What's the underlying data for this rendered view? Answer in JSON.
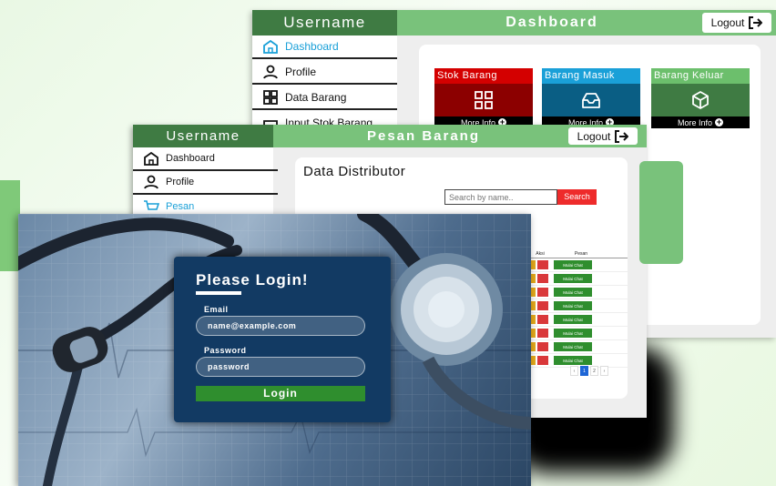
{
  "dashboard": {
    "username": "Username",
    "title": "Dashboard",
    "logout": "Logout",
    "sidebar": [
      {
        "label": "Dashboard",
        "icon": "home-icon",
        "active": true
      },
      {
        "label": "Profile",
        "icon": "user-icon"
      },
      {
        "label": "Data Barang",
        "icon": "grid-icon"
      },
      {
        "label": "Input Stok Barang",
        "icon": "inbox-icon"
      }
    ],
    "cards": [
      {
        "title": "Stok Barang",
        "more": "More Info",
        "icon": "grid-icon",
        "head_color": "#d40000",
        "body_color": "#8c0000"
      },
      {
        "title": "Barang Masuk",
        "more": "More Info",
        "icon": "inbox-icon",
        "head_color": "#1aa0d8",
        "body_color": "#0a5e84"
      },
      {
        "title": "Barang Keluar",
        "more": "More Info",
        "icon": "box-icon",
        "head_color": "#6cbf6c",
        "body_color": "#3f7b43"
      }
    ]
  },
  "pesan": {
    "username": "Username",
    "title": "Pesan Barang",
    "logout": "Logout",
    "sidebar": [
      {
        "label": "Dashboard",
        "icon": "home-icon"
      },
      {
        "label": "Profile",
        "icon": "user-icon"
      },
      {
        "label": "Pesan",
        "icon": "cart-icon",
        "active": true
      }
    ],
    "main_title": "Data Distributor",
    "search_placeholder": "Search by name..",
    "search_button": "Search",
    "table_headers": [
      "Aksi",
      "Pesan"
    ],
    "rows": [
      "Mulai Chat",
      "Mulai Chat",
      "Mulai Chat",
      "Mulai Chat",
      "Mulai Chat",
      "Mulai Chat",
      "Mulai Chat",
      "Mulai Chat"
    ],
    "pages": [
      "‹",
      "1",
      "2",
      "›"
    ]
  },
  "login": {
    "title": "Please Login!",
    "email_label": "Email",
    "email_value": "name@example.com",
    "password_label": "Password",
    "password_value": "password",
    "button": "Login"
  },
  "colors": {
    "header_green": "#79c27b",
    "dark_green": "#3f7b43",
    "login_card": "#123a63",
    "login_button": "#2f8e2e",
    "search_red": "#ee2b2b"
  }
}
